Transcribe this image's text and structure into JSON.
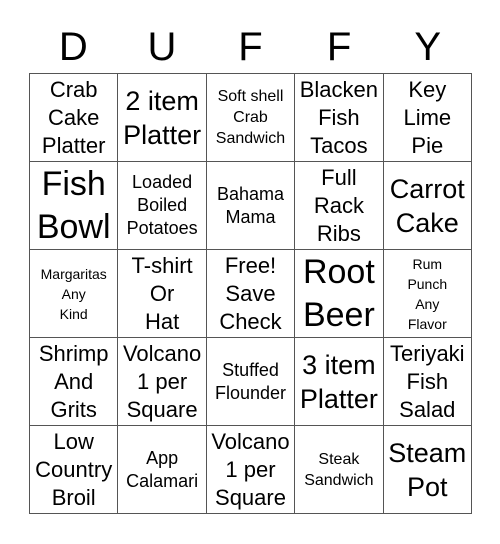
{
  "header": {
    "letters": [
      "D",
      "U",
      "F",
      "F",
      "Y"
    ]
  },
  "board": {
    "cells": [
      {
        "text": "Crab\nCake\nPlatter",
        "size": "s-m"
      },
      {
        "text": "2 item\nPlatter",
        "size": "s-l"
      },
      {
        "text": "Soft shell\nCrab\nSandwich",
        "size": "s-xs"
      },
      {
        "text": "Blacken\nFish\nTacos",
        "size": "s-m"
      },
      {
        "text": "Key\nLime\nPie",
        "size": "s-m"
      },
      {
        "text": "Fish\nBowl",
        "size": "s-xl"
      },
      {
        "text": "Loaded\nBoiled\nPotatoes",
        "size": "s-s"
      },
      {
        "text": "Bahama\nMama",
        "size": "s-s"
      },
      {
        "text": "Full\nRack\nRibs",
        "size": "s-m"
      },
      {
        "text": "Carrot\nCake",
        "size": "s-l"
      },
      {
        "text": "Margaritas\nAny\nKind",
        "size": "s-xxs"
      },
      {
        "text": "T-shirt\nOr\nHat",
        "size": "s-m"
      },
      {
        "text": "Free!\nSave\nCheck",
        "size": "s-m"
      },
      {
        "text": "Root\nBeer",
        "size": "s-xl"
      },
      {
        "text": "Rum\nPunch\nAny\nFlavor",
        "size": "s-xxs"
      },
      {
        "text": "Shrimp\nAnd\nGrits",
        "size": "s-m"
      },
      {
        "text": "Volcano\n1 per\nSquare",
        "size": "s-m"
      },
      {
        "text": "Stuffed\nFlounder",
        "size": "s-s"
      },
      {
        "text": "3 item\nPlatter",
        "size": "s-l"
      },
      {
        "text": "Teriyaki\nFish\nSalad",
        "size": "s-m"
      },
      {
        "text": "Low\nCountry\nBroil",
        "size": "s-m"
      },
      {
        "text": "App\nCalamari",
        "size": "s-s"
      },
      {
        "text": "Volcano\n1 per\nSquare",
        "size": "s-m"
      },
      {
        "text": "Steak\nSandwich",
        "size": "s-xs"
      },
      {
        "text": "Steam\nPot",
        "size": "s-l"
      }
    ]
  }
}
